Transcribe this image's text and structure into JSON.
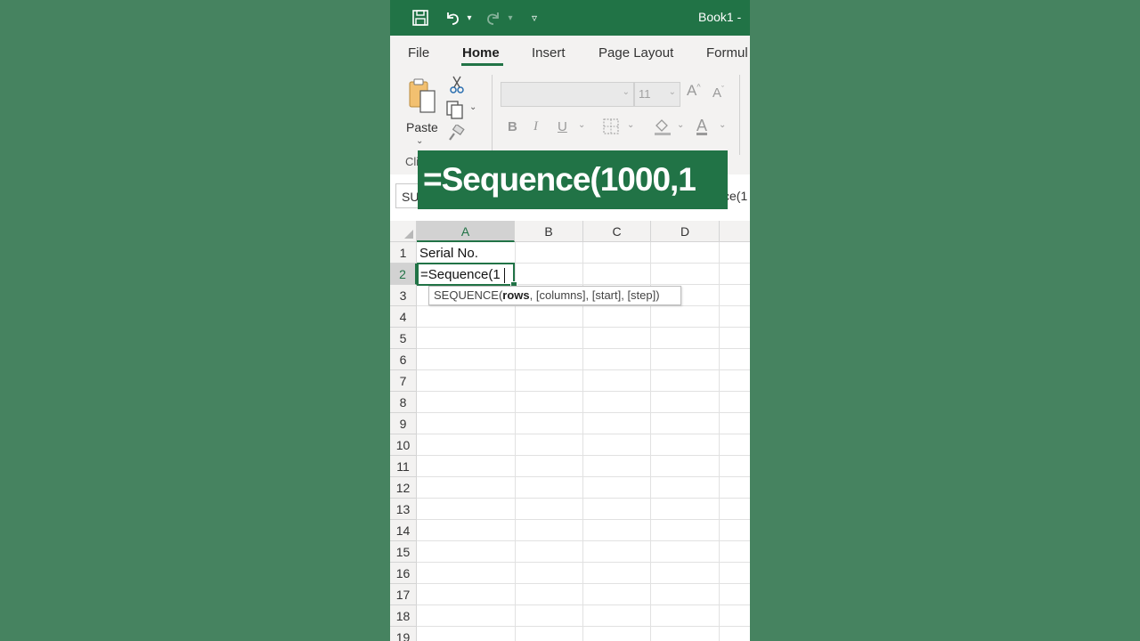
{
  "titlebar": {
    "title": "Book1  -",
    "icons": [
      "save-icon",
      "undo-icon",
      "redo-icon",
      "customize-quick-access-icon"
    ]
  },
  "ribbon": {
    "tabs": [
      "File",
      "Home",
      "Insert",
      "Page Layout",
      "Formul"
    ],
    "active_tab": "Home",
    "clipboard": {
      "paste_label": "Paste",
      "group_label": "Cli"
    },
    "font": {
      "size": "11",
      "bold": "B",
      "italic": "I",
      "underline": "U",
      "grow": "A",
      "shrink": "A",
      "font_color": "A"
    }
  },
  "banner": {
    "text": "=Sequence(1000,1"
  },
  "formula_bar": {
    "name_box": "SU",
    "content_tail": "ce(1"
  },
  "sheet": {
    "columns": [
      "A",
      "B",
      "C",
      "D"
    ],
    "rows": [
      "1",
      "2",
      "3",
      "4",
      "5",
      "6",
      "7",
      "8",
      "9",
      "10",
      "11",
      "12",
      "13",
      "14",
      "15",
      "16",
      "17",
      "18",
      "19"
    ],
    "cells": {
      "A1": "Serial No.",
      "A2": "=Sequence(1"
    },
    "active_cell": "A2",
    "tooltip": {
      "func": "SEQUENCE(",
      "arg_bold": "rows",
      "rest": ", [columns], [start], [step])"
    }
  },
  "colors": {
    "excel_green": "#217346",
    "background": "#468360"
  }
}
